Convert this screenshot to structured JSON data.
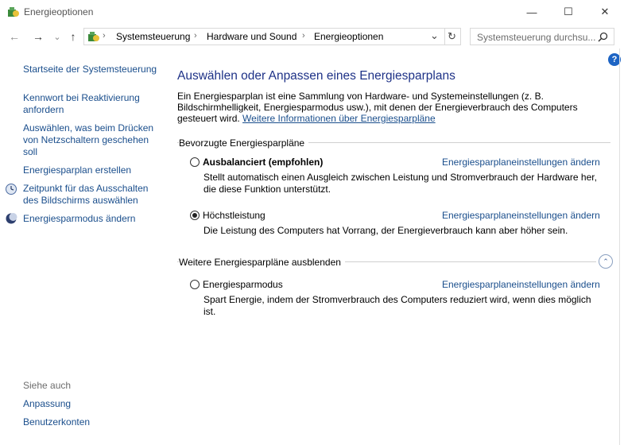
{
  "window": {
    "title": "Energieoptionen",
    "minimize_glyph": "—",
    "maximize_glyph": "☐",
    "close_glyph": "✕"
  },
  "nav": {
    "back_glyph": "←",
    "forward_glyph": "→",
    "recent_glyph": "⌄",
    "up_glyph": "↑"
  },
  "address": {
    "crumbs": [
      "Systemsteuerung",
      "Hardware und Sound",
      "Energieoptionen"
    ],
    "separator": "›",
    "dropdown_glyph": "⌄",
    "refresh_glyph": "↻"
  },
  "search": {
    "placeholder": "Systemsteuerung durchsu...",
    "icon": "search-icon"
  },
  "sidebar": {
    "home": "Startseite der Systemsteuerung",
    "items": [
      "Kennwort bei Reaktivierung anfordern",
      "Auswählen, was beim Drücken von Netzschaltern geschehen soll",
      "Energiesparplan erstellen",
      "Zeitpunkt für das Ausschalten des Bildschirms auswählen",
      "Energiesparmodus ändern"
    ],
    "see_also_heading": "Siehe auch",
    "see_also": [
      "Anpassung",
      "Benutzerkonten"
    ]
  },
  "main": {
    "title": "Auswählen oder Anpassen eines Energiesparplans",
    "description": "Ein Energiesparplan ist eine Sammlung von Hardware- und Systemeinstellungen (z. B. Bildschirmhelligkeit, Energiesparmodus usw.), mit denen der Energieverbrauch des Computers gesteuert wird.",
    "more_info_link": "Weitere Informationen über Energiesparpläne",
    "preferred_heading": "Bevorzugte Energiesparpläne",
    "more_heading": "Weitere Energiesparpläne ausblenden",
    "change_link": "Energiesparplaneinstellungen ändern",
    "plans": [
      {
        "name": "Ausbalanciert (empfohlen)",
        "selected": false,
        "description": "Stellt automatisch einen Ausgleich zwischen Leistung und Stromverbrauch der Hardware her, die diese Funktion unterstützt."
      },
      {
        "name": "Höchstleistung",
        "selected": true,
        "description": "Die Leistung des Computers hat Vorrang, der Energieverbrauch kann aber höher sein."
      },
      {
        "name": "Energiesparmodus",
        "selected": false,
        "description": "Spart Energie, indem der Stromverbrauch des Computers reduziert wird, wenn dies möglich ist."
      }
    ],
    "help_glyph": "?",
    "collapse_glyph": "⌃"
  },
  "colors": {
    "link": "#1a4e8c",
    "title": "#1e3287",
    "help_badge": "#1d64c4"
  }
}
